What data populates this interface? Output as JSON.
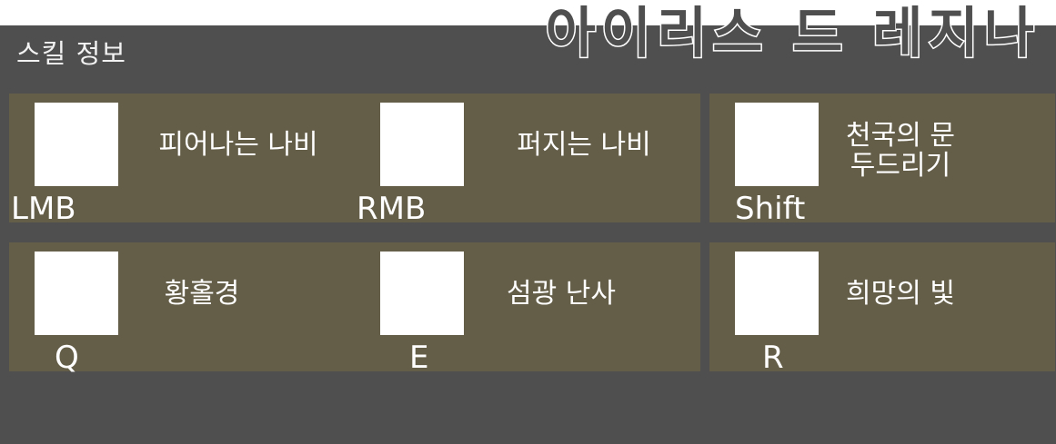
{
  "header": {
    "section_title": "스킬 정보",
    "character_name": "아이리스 드 레지나"
  },
  "skills": [
    {
      "key": "LMB",
      "name": "피어나는 나비"
    },
    {
      "key": "RMB",
      "name": "퍼지는 나비"
    },
    {
      "key": "Shift",
      "name": "천국의 문\n두드리기"
    },
    {
      "key": "Q",
      "name": "황홀경"
    },
    {
      "key": "E",
      "name": "섬광 난사"
    },
    {
      "key": "R",
      "name": "희망의 빛"
    }
  ],
  "colors": {
    "panel_background": "#4f4f4f",
    "card_background": "#645e48",
    "icon_placeholder": "#ffffff",
    "text": "#ffffff"
  }
}
